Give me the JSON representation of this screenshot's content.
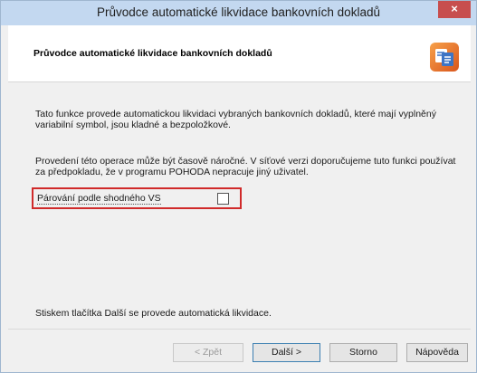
{
  "window": {
    "title": "Průvodce automatické likvidace bankovních dokladů",
    "close_glyph": "×"
  },
  "header": {
    "title": "Průvodce automatické likvidace bankovních dokladů",
    "logo_icon": "pohoda-logo-icon"
  },
  "content": {
    "paragraph1": "Tato funkce provede automatickou likvidaci vybraných bankovních dokladů, které mají vyplněný variabilní symbol, jsou kladné a bezpoložkové.",
    "paragraph2": "Provedení této operace může být časově náročné. V síťové verzi doporučujeme tuto funkci používat za předpokladu, že v programu POHODA nepracuje jiný uživatel.",
    "option_label": "Párování podle shodného VS",
    "option_checked": false,
    "paragraph3": "Stiskem tlačítka Další se provede automatická likvidace."
  },
  "buttons": {
    "back": "< Zpět",
    "next": "Další >",
    "cancel": "Storno",
    "help": "Nápověda"
  },
  "colors": {
    "title_bar": "#c3d8f0",
    "close_button": "#c74e4e",
    "highlight_border": "#d02a2a"
  }
}
